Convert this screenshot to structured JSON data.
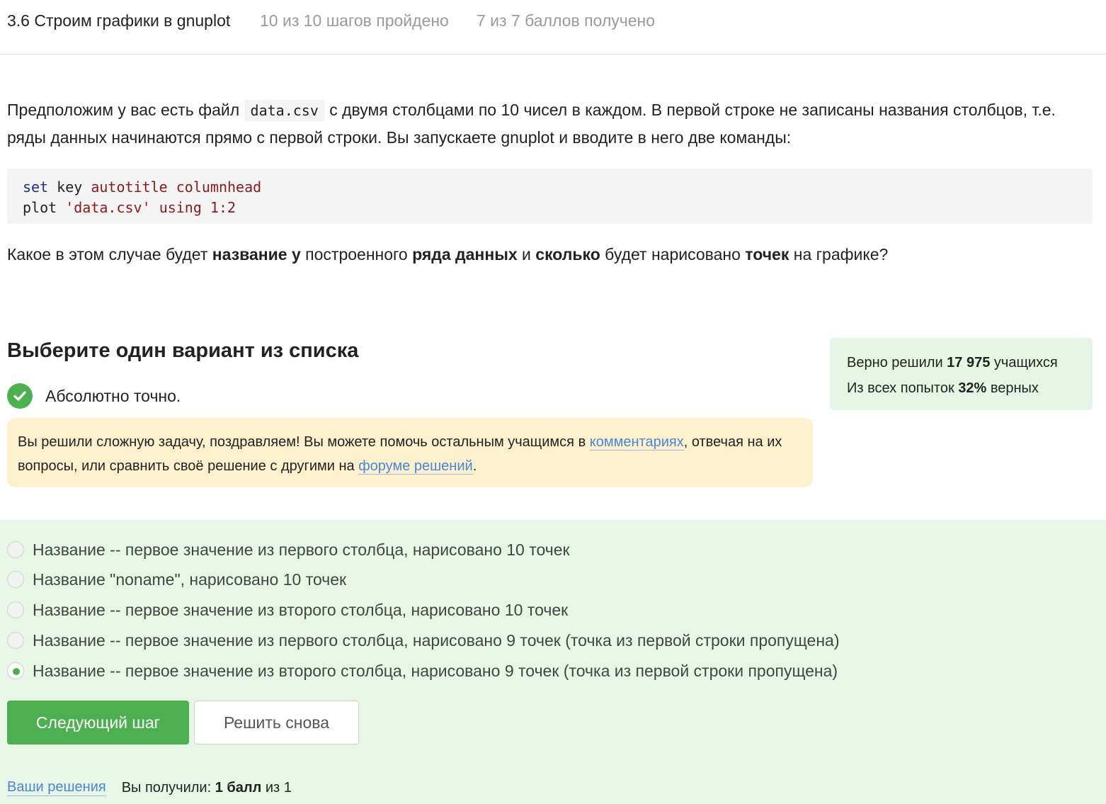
{
  "header": {
    "lesson_title": "3.6 Строим графики в gnuplot",
    "steps_progress": "10 из 10 шагов пройдено",
    "points_progress": "7 из 7 баллов  получено"
  },
  "question": {
    "intro_part1": "Предположим у вас есть файл ",
    "filename": "data.csv",
    "intro_part2": " с двумя столбцами по 10 чисел в каждом. В первой строке не записаны названия столбцов, т.е. ряды данных начинаются прямо с первой строки. Вы запускаете gnuplot и вводите в него две команды:",
    "code": {
      "line1": {
        "kw": "set",
        "id": "key",
        "attr": "autotitle columnhead"
      },
      "line2": {
        "kw": "plot",
        "str": "'data.csv'",
        "rest": "using 1:2"
      }
    },
    "ask_parts": [
      "Какое в этом случае будет ",
      "название у",
      " построенного ",
      "ряда данных",
      " и ",
      "сколько",
      " будет нарисовано ",
      "точек",
      " на графике?"
    ]
  },
  "choice": {
    "title": "Выберите один вариант из списка",
    "result_text": "Абсолютно точно.",
    "feedback": {
      "part1": "Вы решили сложную задачу, поздравляем! Вы можете помочь остальным учащимся в ",
      "link_comments": "комментариях",
      "part2": ", отвечая на их вопросы, или сравнить своё решение с другими на ",
      "link_forum": "форуме решений",
      "part3": "."
    },
    "options": [
      {
        "label": "Название -- первое значение из первого столбца, нарисовано 10 точек",
        "checked": false
      },
      {
        "label": "Название \"noname\", нарисовано 10 точек",
        "checked": false
      },
      {
        "label": "Название -- первое значение из второго столбца, нарисовано 10 точек",
        "checked": false
      },
      {
        "label": "Название -- первое значение из первого столбца, нарисовано 9 точек (точка из первой строки пропущена)",
        "checked": false
      },
      {
        "label": "Название -- первое значение из второго столбца, нарисовано 9 точек (точка из первой строки пропущена)",
        "checked": true
      }
    ]
  },
  "stats": {
    "solved_prefix": "Верно решили ",
    "solved_count": "17 975",
    "solved_suffix": " учащихся",
    "attempts_prefix": "Из всех попыток ",
    "attempts_percent": "32%",
    "attempts_suffix": " верных"
  },
  "buttons": {
    "next_label": "Следующий шаг",
    "retry_label": "Решить снова"
  },
  "footer": {
    "solutions_link": "Ваши решения",
    "score_prefix": "Вы получили: ",
    "score_value": "1 балл",
    "score_suffix": " из 1"
  },
  "colors": {
    "accent_green": "#4caf50",
    "answer_bg": "#e8f6e8",
    "feedback_bg": "#fdf0cd",
    "link": "#4a86d8"
  }
}
